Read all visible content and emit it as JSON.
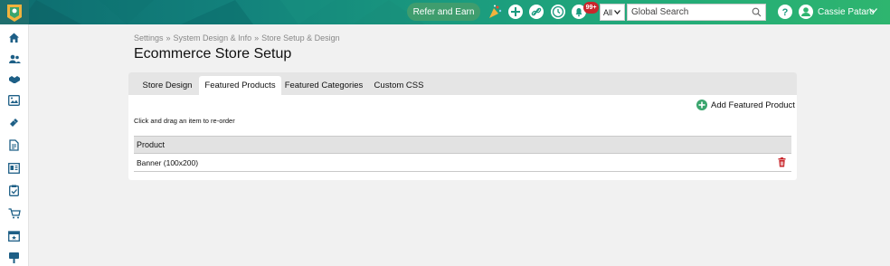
{
  "header": {
    "refer_label": "Refer and Earn",
    "notification_count": "99+",
    "scope_value": "All",
    "search_placeholder": "Global Search",
    "user_name": "Cassie Pataro",
    "icons": [
      "celebrate-icon",
      "plus-circle-icon",
      "link-icon",
      "clock-icon",
      "bell-icon",
      "help-icon",
      "user-avatar-icon"
    ]
  },
  "sidebar": {
    "icons": [
      "home-icon",
      "people-icon",
      "handshake-icon",
      "image-icon",
      "ticket-icon",
      "document-icon",
      "newsletter-icon",
      "checklist-icon",
      "cart-icon",
      "calendar-star-icon",
      "sign-icon"
    ]
  },
  "breadcrumb": [
    "Settings",
    "System Design & Info",
    "Store Setup & Design"
  ],
  "breadcrumb_sep": "»",
  "page_title": "Ecommerce Store Setup",
  "tabs": [
    {
      "label": "Store Design",
      "active": false
    },
    {
      "label": "Featured Products",
      "active": true
    },
    {
      "label": "Featured Categories",
      "active": false
    },
    {
      "label": "Custom CSS",
      "active": false
    }
  ],
  "add_button_label": "Add Featured Product",
  "instruction": "Click and drag an item to re-order",
  "table": {
    "header": "Product",
    "rows": [
      "Banner (100x200)"
    ]
  },
  "colors": {
    "accent_green": "#3aa56d",
    "delete_red": "#c8262b",
    "topbar_teal": "#12807b"
  }
}
